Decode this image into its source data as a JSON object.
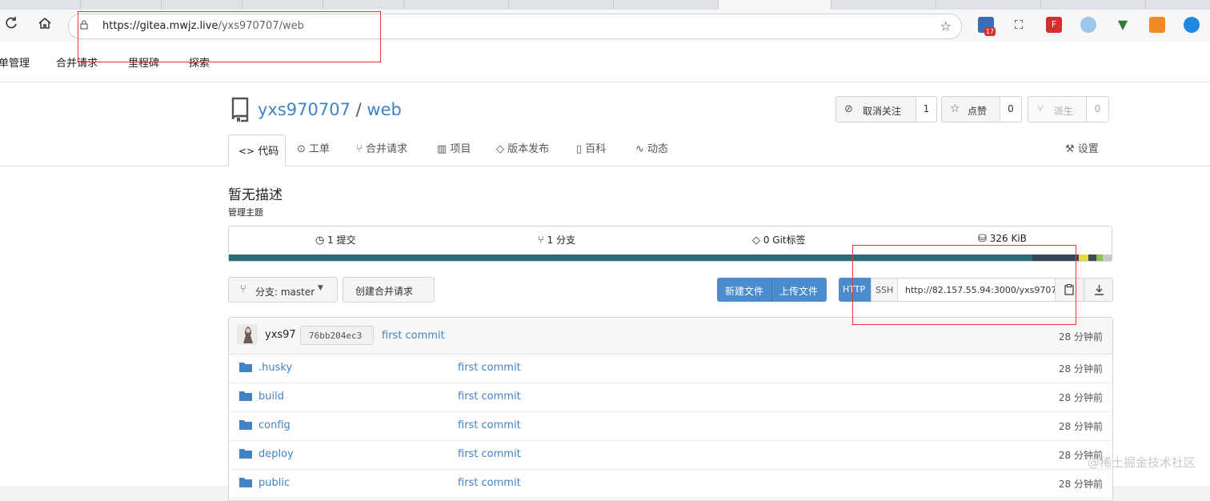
{
  "browser": {
    "url_host": "https://gitea.mwjz.live",
    "url_path": "/yxs970707/web",
    "ext_badge": "17"
  },
  "topnav": {
    "items": [
      "单管理",
      "合并请求",
      "里程碑",
      "探索"
    ]
  },
  "repo": {
    "owner": "yxs970707",
    "separator": "/",
    "name": "web",
    "unwatch_label": "取消关注",
    "watch_count": "1",
    "star_label": "点赞",
    "star_count": "0",
    "fork_label": "派生",
    "fork_count": "0"
  },
  "tabs": {
    "code": "代码",
    "issues": "工单",
    "pulls": "合并请求",
    "projects": "项目",
    "releases": "版本发布",
    "wiki": "百科",
    "activity": "动态",
    "settings": "设置"
  },
  "description": "暂无描述",
  "manage_topics": "管理主题",
  "stats": {
    "commits": "1 提交",
    "branches": "1 分支",
    "tags": "0 Git标签",
    "size": "326 KiB"
  },
  "lang_colors": [
    "#2b6b7a",
    "#384457",
    "#e8d94a",
    "#3d4a5a",
    "#8bc34a",
    "#c9c9c9"
  ],
  "toolbar": {
    "branch_label": "分支: master",
    "new_pr": "创建合并请求",
    "new_file": "新建文件",
    "upload_file": "上传文件",
    "http": "HTTP",
    "ssh": "SSH",
    "clone_url": "http://82.157.55.94:3000/yxs97070"
  },
  "latest_commit": {
    "author": "yxs97",
    "sha": "76bb204ec3",
    "message": "first commit",
    "time": "28 分钟前"
  },
  "files": [
    {
      "name": ".husky",
      "message": "first commit",
      "time": "28 分钟前"
    },
    {
      "name": "build",
      "message": "first commit",
      "time": "28 分钟前"
    },
    {
      "name": "config",
      "message": "first commit",
      "time": "28 分钟前"
    },
    {
      "name": "deploy",
      "message": "first commit",
      "time": "28 分钟前"
    },
    {
      "name": "public",
      "message": "first commit",
      "time": "28 分钟前"
    }
  ],
  "watermark": "@稀土掘金技术社区"
}
